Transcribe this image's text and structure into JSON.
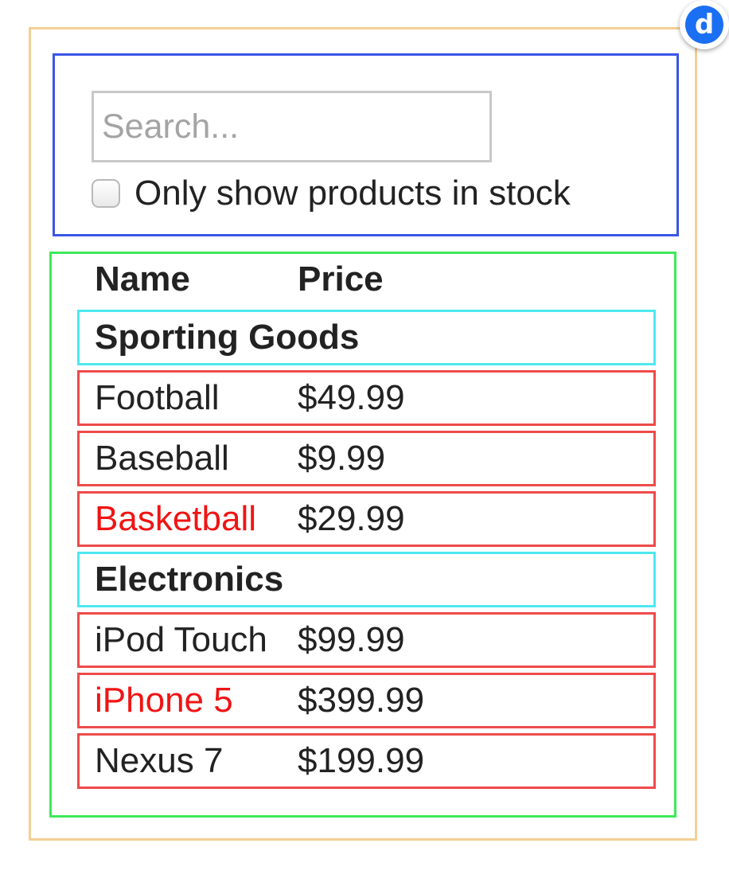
{
  "search": {
    "placeholder": "Search...",
    "value": "",
    "in_stock_label": "Only show products in stock",
    "in_stock_checked": false
  },
  "table": {
    "headers": {
      "name": "Name",
      "price": "Price"
    },
    "categories": [
      {
        "name": "Sporting Goods",
        "products": [
          {
            "name": "Football",
            "price": "$49.99",
            "stocked": true
          },
          {
            "name": "Baseball",
            "price": "$9.99",
            "stocked": true
          },
          {
            "name": "Basketball",
            "price": "$29.99",
            "stocked": false
          }
        ]
      },
      {
        "name": "Electronics",
        "products": [
          {
            "name": "iPod Touch",
            "price": "$99.99",
            "stocked": true
          },
          {
            "name": "iPhone 5",
            "price": "$399.99",
            "stocked": false
          },
          {
            "name": "Nexus 7",
            "price": "$199.99",
            "stocked": true
          }
        ]
      }
    ]
  },
  "colors": {
    "app_frame": "#f5cf94",
    "search_bar": "#3a55e8",
    "product_table": "#3fe85a",
    "category_row": "#4ee8f0",
    "product_row": "#ee4b4b",
    "out_of_stock_text": "#f01414"
  },
  "badge": {
    "icon": "d-logo-icon",
    "glyph": "d"
  }
}
